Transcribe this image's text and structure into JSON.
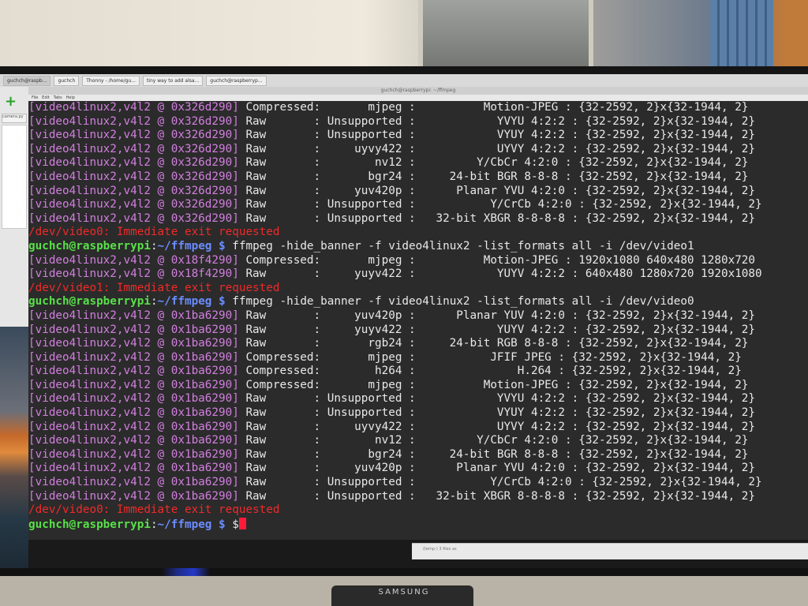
{
  "desktop": {
    "taskbar_items": [
      "guchch@raspb...",
      "guchch",
      "Thonny - /home/gu...",
      "tiny way to add alsa...",
      "guchch@raspberryp..."
    ],
    "left_app_tab": "camera.py",
    "mini_window_label": "(temp-) 3 files as"
  },
  "terminal": {
    "title": "guchch@raspberrypi: ~/ffmpeg",
    "menu": [
      "File",
      "Edit",
      "Tabs",
      "Help"
    ],
    "lines": [
      {
        "kind": "fmt",
        "tag": "[video4linux2,v4l2 @ 0x326d290]",
        "rest": " Compressed:       mjpeg :          Motion-JPEG : {32-2592, 2}x{32-1944, 2}"
      },
      {
        "kind": "fmt",
        "tag": "[video4linux2,v4l2 @ 0x326d290]",
        "rest": " Raw       : Unsupported :            YVYU 4:2:2 : {32-2592, 2}x{32-1944, 2}"
      },
      {
        "kind": "fmt",
        "tag": "[video4linux2,v4l2 @ 0x326d290]",
        "rest": " Raw       : Unsupported :            VYUY 4:2:2 : {32-2592, 2}x{32-1944, 2}"
      },
      {
        "kind": "fmt",
        "tag": "[video4linux2,v4l2 @ 0x326d290]",
        "rest": " Raw       :     uyvy422 :            UYVY 4:2:2 : {32-2592, 2}x{32-1944, 2}"
      },
      {
        "kind": "fmt",
        "tag": "[video4linux2,v4l2 @ 0x326d290]",
        "rest": " Raw       :        nv12 :         Y/CbCr 4:2:0 : {32-2592, 2}x{32-1944, 2}"
      },
      {
        "kind": "fmt",
        "tag": "[video4linux2,v4l2 @ 0x326d290]",
        "rest": " Raw       :       bgr24 :     24-bit BGR 8-8-8 : {32-2592, 2}x{32-1944, 2}"
      },
      {
        "kind": "fmt",
        "tag": "[video4linux2,v4l2 @ 0x326d290]",
        "rest": " Raw       :     yuv420p :      Planar YVU 4:2:0 : {32-2592, 2}x{32-1944, 2}"
      },
      {
        "kind": "fmt",
        "tag": "[video4linux2,v4l2 @ 0x326d290]",
        "rest": " Raw       : Unsupported :           Y/CrCb 4:2:0 : {32-2592, 2}x{32-1944, 2}"
      },
      {
        "kind": "fmt",
        "tag": "[video4linux2,v4l2 @ 0x326d290]",
        "rest": " Raw       : Unsupported :   32-bit XBGR 8-8-8-8 : {32-2592, 2}x{32-1944, 2}"
      },
      {
        "kind": "err",
        "text": "/dev/video0: Immediate exit requested"
      },
      {
        "kind": "prompt",
        "user": "guchch@raspberrypi",
        "path": "~/ffmpeg",
        "symbol": " $ ",
        "cmd": "ffmpeg -hide_banner -f video4linux2 -list_formats all -i /dev/video1"
      },
      {
        "kind": "fmt",
        "tag": "[video4linux2,v4l2 @ 0x18f4290]",
        "rest": " Compressed:       mjpeg :          Motion-JPEG : 1920x1080 640x480 1280x720"
      },
      {
        "kind": "fmt",
        "tag": "[video4linux2,v4l2 @ 0x18f4290]",
        "rest": " Raw       :     yuyv422 :            YUYV 4:2:2 : 640x480 1280x720 1920x1080"
      },
      {
        "kind": "err",
        "text": "/dev/video1: Immediate exit requested"
      },
      {
        "kind": "prompt",
        "user": "guchch@raspberrypi",
        "path": "~/ffmpeg",
        "symbol": " $ ",
        "cmd": "ffmpeg -hide_banner -f video4linux2 -list_formats all -i /dev/video0"
      },
      {
        "kind": "fmt",
        "tag": "[video4linux2,v4l2 @ 0x1ba6290]",
        "rest": " Raw       :     yuv420p :      Planar YUV 4:2:0 : {32-2592, 2}x{32-1944, 2}"
      },
      {
        "kind": "fmt",
        "tag": "[video4linux2,v4l2 @ 0x1ba6290]",
        "rest": " Raw       :     yuyv422 :            YUYV 4:2:2 : {32-2592, 2}x{32-1944, 2}"
      },
      {
        "kind": "fmt",
        "tag": "[video4linux2,v4l2 @ 0x1ba6290]",
        "rest": " Raw       :       rgb24 :     24-bit RGB 8-8-8 : {32-2592, 2}x{32-1944, 2}"
      },
      {
        "kind": "fmt",
        "tag": "[video4linux2,v4l2 @ 0x1ba6290]",
        "rest": " Compressed:       mjpeg :           JFIF JPEG : {32-2592, 2}x{32-1944, 2}"
      },
      {
        "kind": "fmt",
        "tag": "[video4linux2,v4l2 @ 0x1ba6290]",
        "rest": " Compressed:        h264 :               H.264 : {32-2592, 2}x{32-1944, 2}"
      },
      {
        "kind": "fmt",
        "tag": "[video4linux2,v4l2 @ 0x1ba6290]",
        "rest": " Compressed:       mjpeg :          Motion-JPEG : {32-2592, 2}x{32-1944, 2}"
      },
      {
        "kind": "fmt",
        "tag": "[video4linux2,v4l2 @ 0x1ba6290]",
        "rest": " Raw       : Unsupported :            YVYU 4:2:2 : {32-2592, 2}x{32-1944, 2}"
      },
      {
        "kind": "fmt",
        "tag": "[video4linux2,v4l2 @ 0x1ba6290]",
        "rest": " Raw       : Unsupported :            VYUY 4:2:2 : {32-2592, 2}x{32-1944, 2}"
      },
      {
        "kind": "fmt",
        "tag": "[video4linux2,v4l2 @ 0x1ba6290]",
        "rest": " Raw       :     uyvy422 :            UYVY 4:2:2 : {32-2592, 2}x{32-1944, 2}"
      },
      {
        "kind": "fmt",
        "tag": "[video4linux2,v4l2 @ 0x1ba6290]",
        "rest": " Raw       :        nv12 :         Y/CbCr 4:2:0 : {32-2592, 2}x{32-1944, 2}"
      },
      {
        "kind": "fmt",
        "tag": "[video4linux2,v4l2 @ 0x1ba6290]",
        "rest": " Raw       :       bgr24 :     24-bit BGR 8-8-8 : {32-2592, 2}x{32-1944, 2}"
      },
      {
        "kind": "fmt",
        "tag": "[video4linux2,v4l2 @ 0x1ba6290]",
        "rest": " Raw       :     yuv420p :      Planar YVU 4:2:0 : {32-2592, 2}x{32-1944, 2}"
      },
      {
        "kind": "fmt",
        "tag": "[video4linux2,v4l2 @ 0x1ba6290]",
        "rest": " Raw       : Unsupported :           Y/CrCb 4:2:0 : {32-2592, 2}x{32-1944, 2}"
      },
      {
        "kind": "fmt",
        "tag": "[video4linux2,v4l2 @ 0x1ba6290]",
        "rest": " Raw       : Unsupported :   32-bit XBGR 8-8-8-8 : {32-2592, 2}x{32-1944, 2}"
      },
      {
        "kind": "err",
        "text": "/dev/video0: Immediate exit requested"
      },
      {
        "kind": "prompt",
        "user": "guchch@raspberrypi",
        "path": "~/ffmpeg",
        "symbol": " $ ",
        "cmd": "$",
        "cursor": true
      }
    ]
  },
  "monitor": {
    "brand": "SAMSUNG"
  },
  "colors": {
    "terminal_bg": "#2b2b2b",
    "log_tag": "#d27fdf",
    "error_text": "#ef2a2a",
    "prompt_user": "#58e048",
    "prompt_path": "#6b8cff",
    "cursor": "#ff1a3a"
  }
}
